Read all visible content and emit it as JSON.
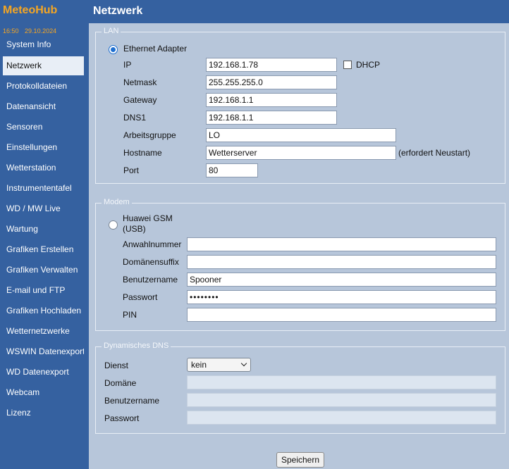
{
  "app": {
    "brand": "MeteoHub",
    "time": "16:50",
    "date": "29.10.2024"
  },
  "sidebar": {
    "items": [
      {
        "label": "System Info"
      },
      {
        "label": "Netzwerk"
      },
      {
        "label": "Protokolldateien"
      },
      {
        "label": "Datenansicht"
      },
      {
        "label": "Sensoren"
      },
      {
        "label": "Einstellungen"
      },
      {
        "label": "Wetterstation"
      },
      {
        "label": "Instrumententafel"
      },
      {
        "label": "WD / MW Live"
      },
      {
        "label": "Wartung"
      },
      {
        "label": "Grafiken Erstellen"
      },
      {
        "label": "Grafiken Verwalten"
      },
      {
        "label": "E-mail und FTP"
      },
      {
        "label": "Grafiken Hochladen"
      },
      {
        "label": "Wetternetzwerke"
      },
      {
        "label": "WSWIN Datenexport"
      },
      {
        "label": "WD Datenexport"
      },
      {
        "label": "Webcam"
      },
      {
        "label": "Lizenz"
      }
    ],
    "active": "Netzwerk"
  },
  "page": {
    "title": "Netzwerk"
  },
  "lan": {
    "legend": "LAN",
    "adapter_label": "Ethernet Adapter",
    "adapter_selected": true,
    "ip_label": "IP",
    "ip_value": "192.168.1.78",
    "dhcp_label": "DHCP",
    "dhcp_checked": false,
    "netmask_label": "Netmask",
    "netmask_value": "255.255.255.0",
    "gateway_label": "Gateway",
    "gateway_value": "192.168.1.1",
    "dns1_label": "DNS1",
    "dns1_value": "192.168.1.1",
    "workgroup_label": "Arbeitsgruppe",
    "workgroup_value": "LO",
    "hostname_label": "Hostname",
    "hostname_value": "Wetterserver",
    "hostname_note": "(erfordert Neustart)",
    "port_label": "Port",
    "port_value": "80"
  },
  "modem": {
    "legend": "Modem",
    "device_line1": "Huawei GSM",
    "device_line2": "(USB)",
    "device_selected": false,
    "dial_label": "Anwahlnummer",
    "dial_value": "",
    "domain_suffix_label": "Domänensuffix",
    "domain_suffix_value": "",
    "username_label": "Benutzername",
    "username_value": "Spooner",
    "password_label": "Passwort",
    "password_value": "••••••••",
    "pin_label": "PIN",
    "pin_value": ""
  },
  "ddns": {
    "legend": "Dynamisches DNS",
    "service_label": "Dienst",
    "service_value": "kein",
    "domain_label": "Domäne",
    "domain_value": "",
    "username_label": "Benutzername",
    "username_value": "",
    "password_label": "Passwort",
    "password_value": ""
  },
  "actions": {
    "save_label": "Speichern"
  }
}
